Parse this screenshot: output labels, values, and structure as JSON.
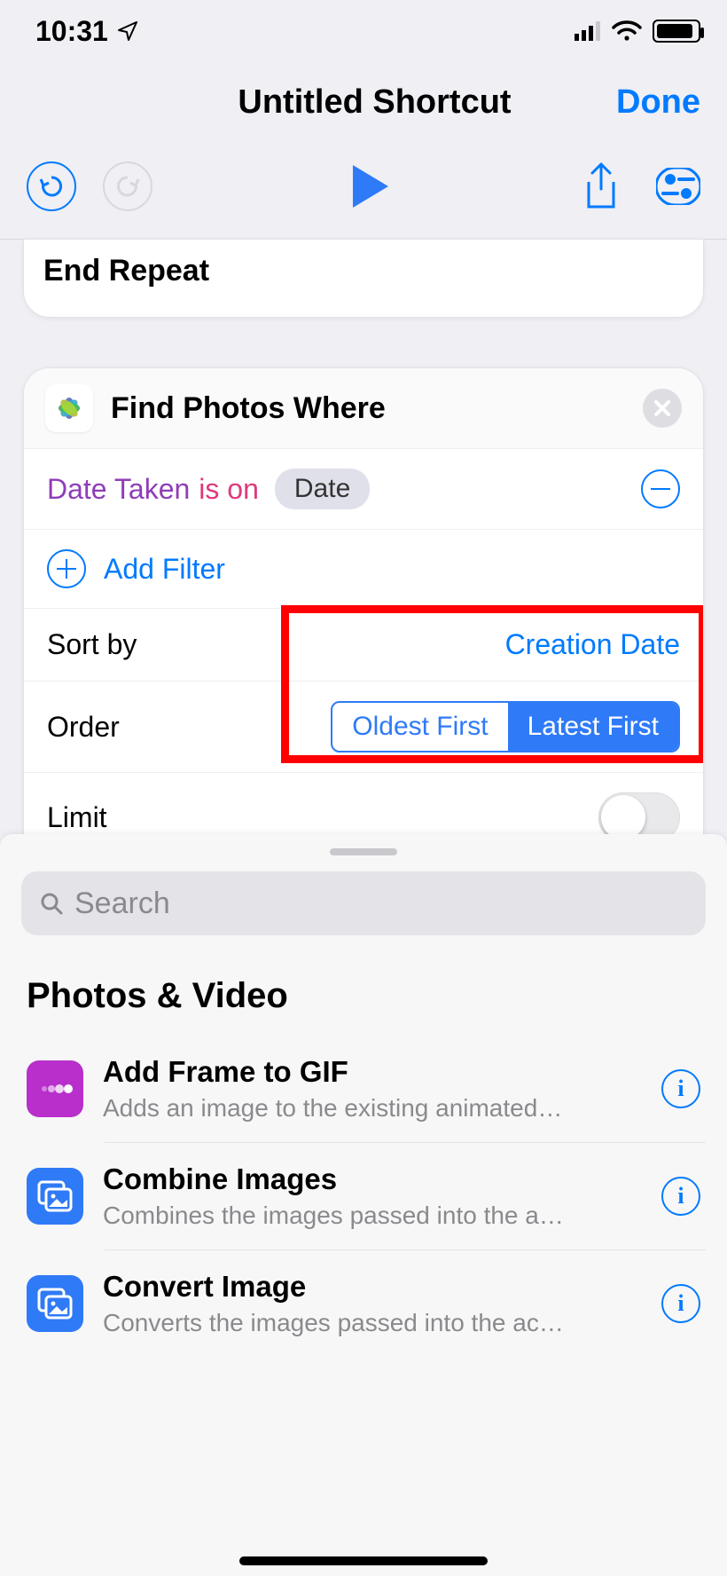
{
  "status": {
    "time": "10:31"
  },
  "nav": {
    "title": "Untitled Shortcut",
    "done": "Done"
  },
  "endrepeat": {
    "label": "End Repeat"
  },
  "find": {
    "title": "Find Photos Where",
    "filter": {
      "field": "Date Taken",
      "op": "is on",
      "value": "Date"
    },
    "addfilter": "Add Filter",
    "sortby_label": "Sort by",
    "sortby_value": "Creation Date",
    "order_label": "Order",
    "order_options": [
      "Oldest First",
      "Latest First"
    ],
    "order_selected": 1,
    "limit_label": "Limit",
    "limit_on": false
  },
  "search": {
    "placeholder": "Search"
  },
  "section": {
    "title": "Photos & Video"
  },
  "actions": [
    {
      "title": "Add Frame to GIF",
      "sub": "Adds an image to the existing animated GI...",
      "icon": "magenta"
    },
    {
      "title": "Combine Images",
      "sub": "Combines the images passed into the acti...",
      "icon": "blue"
    },
    {
      "title": "Convert Image",
      "sub": "Converts the images passed into the actio...",
      "icon": "blue"
    }
  ]
}
